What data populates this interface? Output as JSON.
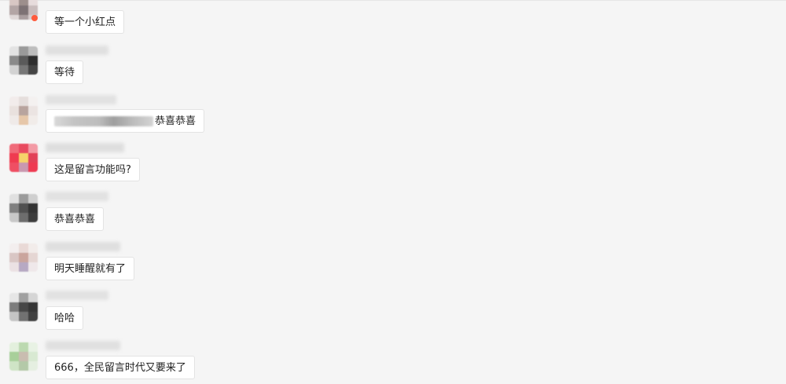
{
  "messages": [
    {
      "id": "m1",
      "text": "等一个小红点",
      "has_redacted_prefix": false
    },
    {
      "id": "m2",
      "text": "等待",
      "has_redacted_prefix": false
    },
    {
      "id": "m3",
      "text": "恭喜恭喜",
      "has_redacted_prefix": true
    },
    {
      "id": "m4",
      "text": "这是留言功能吗?",
      "has_redacted_prefix": false
    },
    {
      "id": "m5",
      "text": "恭喜恭喜",
      "has_redacted_prefix": false
    },
    {
      "id": "m6",
      "text": "明天睡醒就有了",
      "has_redacted_prefix": false
    },
    {
      "id": "m7",
      "text": "哈哈",
      "has_redacted_prefix": false
    },
    {
      "id": "m8",
      "text": "666，全民留言时代又要来了",
      "has_redacted_prefix": false
    }
  ],
  "colors": {
    "background": "#f5f5f5",
    "bubble": "#ffffff",
    "bubble_border": "#e3e3e3",
    "text": "#222222",
    "badge": "#ff5a3c"
  }
}
